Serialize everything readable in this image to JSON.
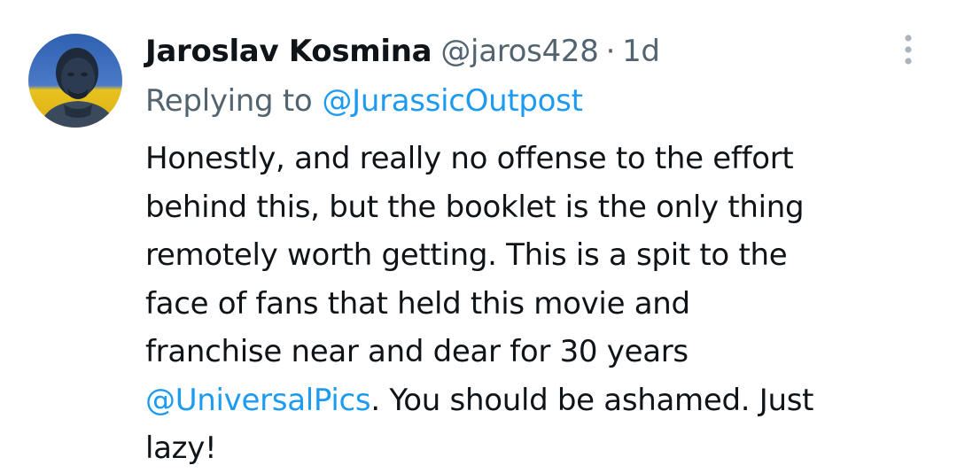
{
  "tweet": {
    "display_name": "Jaroslav Kosmina",
    "handle": "@jaros428",
    "separator": "·",
    "time": "1d",
    "reply_label": "Replying to",
    "reply_to": "@JurassicOutpost",
    "avatar_icon": "profile-photo-blue-yellow",
    "more_icon": "vertical-ellipsis",
    "body_lines": [
      "Honestly, and really no offense to the effort",
      "behind this, but the booklet is the only thing",
      "remotely worth getting. This is a spit to the",
      "face of fans that held this movie and",
      "franchise near and dear for 30 years"
    ],
    "mention_2": "@UniversalPics",
    "line6_rest": ". You should be ashamed. Just",
    "line7": "lazy!"
  },
  "colors": {
    "text": "#0f1419",
    "secondary": "#536471",
    "link": "#1d9bf0",
    "avatar_blue": "#2f5fb0",
    "avatar_yellow": "#e8c21e"
  }
}
